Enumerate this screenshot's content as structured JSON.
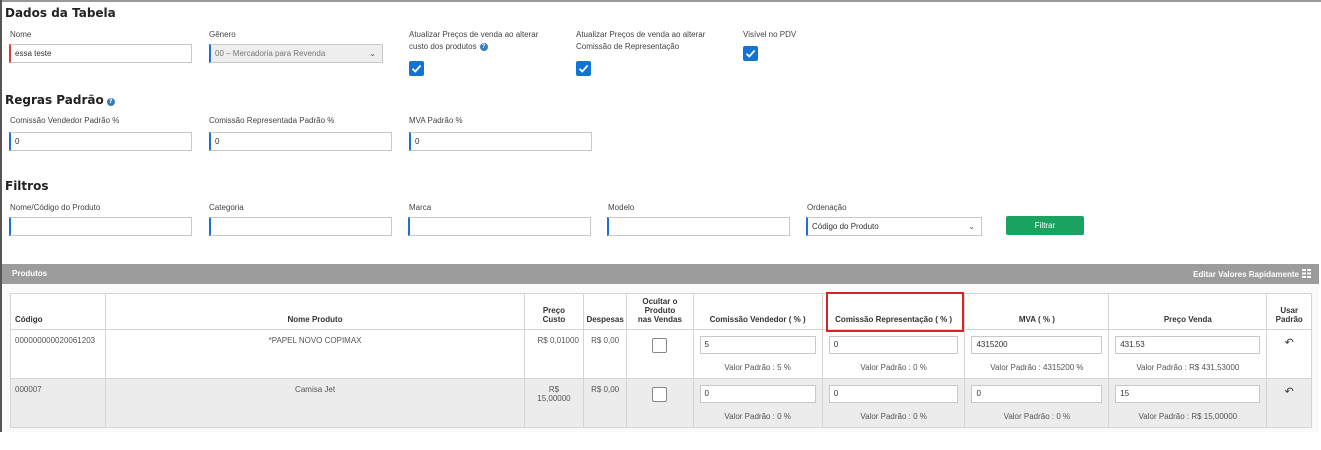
{
  "dados": {
    "title": "Dados da Tabela",
    "nome_label": "Nome",
    "nome_value": "essa teste",
    "genero_label": "Gênero",
    "genero_value": "00 – Mercadoria para Revenda",
    "atualizar_custo_label_1": "Atualizar Preços de venda ao alterar",
    "atualizar_custo_label_2": "custo dos produtos",
    "atualizar_comissao_label_1": "Atualizar Preços de venda ao alterar",
    "atualizar_comissao_label_2": "Comissão de Representação",
    "visivel_label": "Visível no PDV",
    "atualizar_custo_checked": true,
    "atualizar_comissao_checked": true,
    "visivel_checked": true
  },
  "regras": {
    "title": "Regras Padrão",
    "comissao_vendedor_label": "Comissão Vendedor Padrão %",
    "comissao_vendedor_value": "0",
    "comissao_representada_label": "Comissão Representada Padrão %",
    "comissao_representada_value": "0",
    "mva_label": "MVA Padrão %",
    "mva_value": "0"
  },
  "filtros": {
    "title": "Filtros",
    "nome_codigo_label": "Nome/Código do Produto",
    "nome_codigo_value": "",
    "categoria_label": "Categoria",
    "categoria_value": "",
    "marca_label": "Marca",
    "marca_value": "",
    "modelo_label": "Modelo",
    "modelo_value": "",
    "ordenacao_label": "Ordenação",
    "ordenacao_value": "Código do Produto",
    "filtrar_button": "Filtrar"
  },
  "produtos": {
    "title": "Produtos",
    "editar_rapido": "Editar Valores Rapidamente",
    "columns": {
      "codigo": "Código",
      "nome": "Nome Produto",
      "preco_custo_1": "Preço",
      "preco_custo_2": "Custo",
      "despesas": "Despesas",
      "ocultar_1": "Ocultar o Produto",
      "ocultar_2": "nas Vendas",
      "comissao_vendedor": "Comissão Vendedor ( % )",
      "comissao_representacao": "Comissão Representação ( % )",
      "mva": "MVA ( % )",
      "preco_venda": "Preço Venda",
      "usar_padrao_1": "Usar",
      "usar_padrao_2": "Padrão"
    },
    "rows": [
      {
        "codigo": "000000000020061203",
        "nome": "*PAPEL NOVO COPIMAX",
        "preco_custo": "R$ 0,01000",
        "despesas": "R$ 0,00",
        "comissao_vendedor": "5",
        "comissao_vendedor_padrao": "Valor Padrão : 5 %",
        "comissao_representacao": "0",
        "comissao_representacao_padrao": "Valor Padrão : 0 %",
        "mva": "4315200",
        "mva_padrao": "Valor Padrão : 4315200 %",
        "preco_venda": "431.53",
        "preco_venda_padrao": "Valor Padrão : R$ 431,53000"
      },
      {
        "codigo": "000007",
        "nome": "Camisa Jet",
        "preco_custo_1": "R$",
        "preco_custo_2": "15,00000",
        "despesas": "R$ 0,00",
        "comissao_vendedor": "0",
        "comissao_vendedor_padrao": "Valor Padrão : 0 %",
        "comissao_representacao": "0",
        "comissao_representacao_padrao": "Valor Padrão : 0 %",
        "mva": "0",
        "mva_padrao": "Valor Padrão : 0 %",
        "preco_venda": "15",
        "preco_venda_padrao": "Valor Padrão : R$ 15,00000"
      }
    ]
  },
  "icons": {
    "help": "help-circle-icon",
    "check": "checkmark-icon",
    "grid": "grid-icon",
    "use_default": "reply-arrow-icon"
  },
  "colors": {
    "accent_blue": "#1173d4",
    "filter_green": "#1aa260",
    "panel_gray": "#9c9c9c",
    "highlight_red": "#d72424"
  }
}
